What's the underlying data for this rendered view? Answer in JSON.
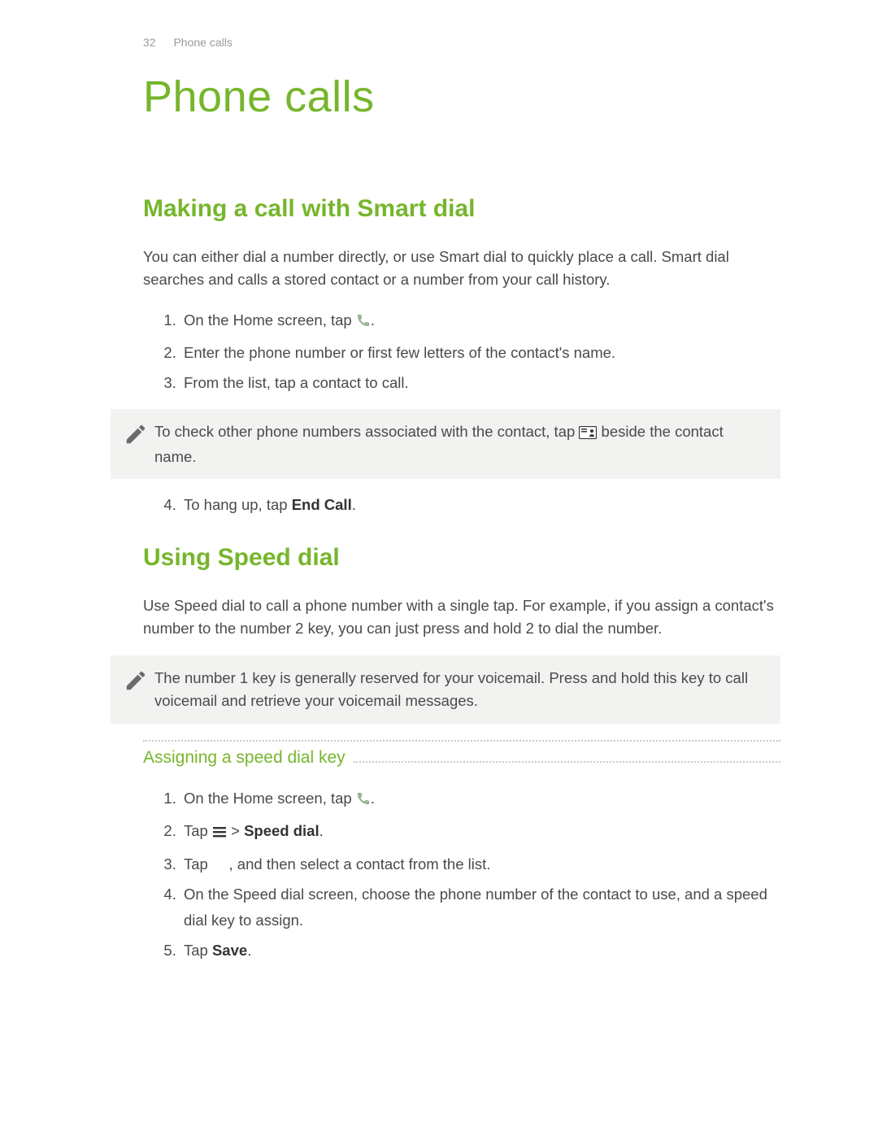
{
  "header": {
    "page_number": "32",
    "chapter": "Phone calls"
  },
  "title": "Phone calls",
  "section1": {
    "heading": "Making a call with Smart dial",
    "intro": "You can either dial a number directly, or use Smart dial to quickly place a call. Smart dial searches and calls a stored contact or a number from your call history.",
    "steps": {
      "s1_pre": "On the Home screen, tap ",
      "s1_post": ".",
      "s2": "Enter the phone number or first few letters of the contact's name.",
      "s3": "From the list, tap a contact to call.",
      "s4_pre": "To hang up, tap ",
      "s4_bold": "End Call",
      "s4_post": "."
    },
    "note": {
      "pre": "To check other phone numbers associated with the contact, tap ",
      "post": " beside the contact name."
    }
  },
  "section2": {
    "heading": "Using Speed dial",
    "intro": "Use Speed dial to call a phone number with a single tap. For example, if you assign a contact's number to the number 2 key, you can just press and hold 2 to dial the number.",
    "note": "The number 1 key is generally reserved for your voicemail. Press and hold this key to call voicemail and retrieve your voicemail messages.",
    "subheading": "Assigning a speed dial key",
    "steps": {
      "s1_pre": "On the Home screen, tap ",
      "s1_post": ".",
      "s2_pre": "Tap ",
      "s2_mid": " > ",
      "s2_bold": "Speed dial",
      "s2_post": ".",
      "s3_pre": "Tap ",
      "s3_post": ", and then select a contact from the list.",
      "s4": "On the Speed dial screen, choose the phone number of the contact to use, and a speed dial key to assign.",
      "s5_pre": "Tap ",
      "s5_bold": "Save",
      "s5_post": "."
    }
  }
}
